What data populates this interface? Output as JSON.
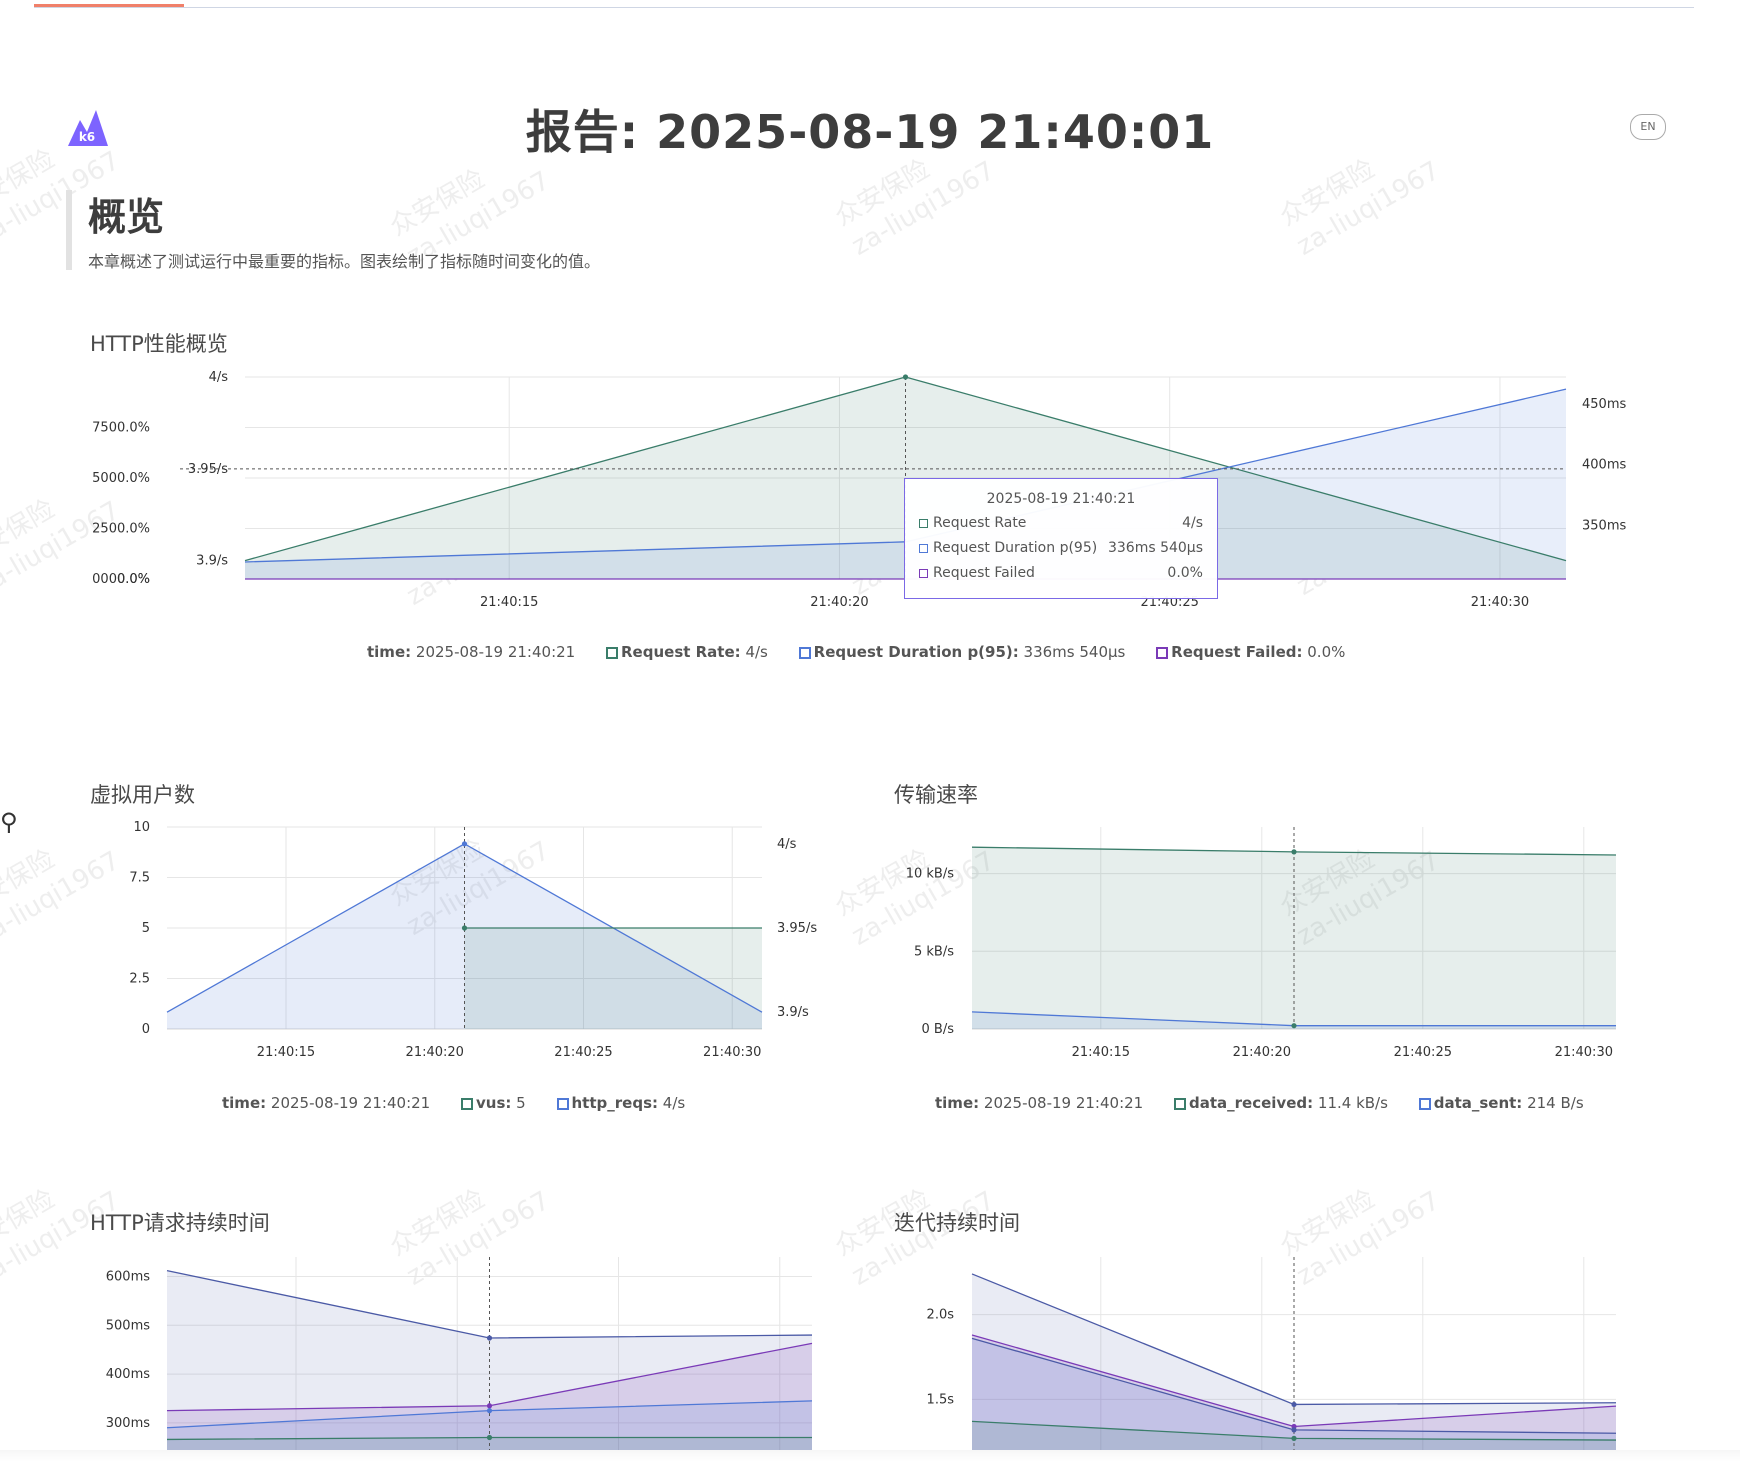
{
  "page": {
    "logo_text": "k6",
    "title": "报告: 2025-08-19 21:40:01",
    "lang_button": "EN",
    "section_title": "概览",
    "section_desc": "本章概述了测试运行中最重要的指标。图表绘制了指标随时间变化的值。"
  },
  "watermark": {
    "line1": "众安保险",
    "line2": "za-liuqi1967"
  },
  "colors": {
    "green": "#3a7d6a",
    "blue": "#4f78d6",
    "purple": "#7a3ab7",
    "navy": "#4b5aa6",
    "title": "#3d3d3d"
  },
  "http_overview": {
    "title": "HTTP性能概览",
    "tooltip": {
      "time": "2025-08-19 21:40:21",
      "rows": [
        {
          "name": "Request Rate",
          "value": "4/s"
        },
        {
          "name": "Request Duration p(95)",
          "value": "336ms 540µs"
        },
        {
          "name": "Request Failed",
          "value": "0.0%"
        }
      ]
    },
    "legend": {
      "time_label": "time:",
      "time_value": "2025-08-19 21:40:21",
      "items": [
        {
          "label": "Request Rate:",
          "value": "4/s"
        },
        {
          "label": "Request Duration p(95):",
          "value": "336ms 540µs"
        },
        {
          "label": "Request Failed:",
          "value": "0.0%"
        }
      ]
    }
  },
  "vus_chart": {
    "title": "虚拟用户数",
    "legend": {
      "time_label": "time:",
      "time_value": "2025-08-19 21:40:21",
      "items": [
        {
          "label": "vus:",
          "value": "5"
        },
        {
          "label": "http_reqs:",
          "value": "4/s"
        }
      ]
    }
  },
  "transfer_chart": {
    "title": "传输速率",
    "legend": {
      "time_label": "time:",
      "time_value": "2025-08-19 21:40:21",
      "items": [
        {
          "label": "data_received:",
          "value": "11.4 kB/s"
        },
        {
          "label": "data_sent:",
          "value": "214 B/s"
        }
      ]
    }
  },
  "http_duration_chart": {
    "title": "HTTP请求持续时间"
  },
  "iteration_chart": {
    "title": "迭代持续时间"
  },
  "chart_data": [
    {
      "type": "area",
      "title": "HTTP性能概览",
      "x": [
        "21:40:11",
        "21:40:21",
        "21:40:31"
      ],
      "x_ticks": [
        "21:40:15",
        "21:40:20",
        "21:40:25",
        "21:40:30"
      ],
      "xlim": [
        "21:40:11",
        "21:40:31"
      ],
      "y_left_pct": {
        "ticks": [
          "0.0%",
          "2500.0%",
          "5000.0%",
          "7500.0%",
          "0000.0%"
        ],
        "ylim": [
          0,
          10000
        ]
      },
      "y_left_rate": {
        "ticks": [
          "3.9/s",
          "3.95/s",
          "4/s"
        ],
        "ylim": [
          3.89,
          4.0
        ]
      },
      "y_right": {
        "ticks": [
          "350ms",
          "400ms",
          "450ms"
        ],
        "ylim": [
          306,
          472
        ]
      },
      "series": [
        {
          "name": "Request Rate",
          "axis": "rate",
          "values": [
            3.9,
            4.0,
            3.9
          ]
        },
        {
          "name": "Request Duration p(95)",
          "axis": "ms",
          "values": [
            320,
            336.54,
            462
          ]
        },
        {
          "name": "Request Failed",
          "axis": "pct",
          "values": [
            0,
            0,
            0
          ]
        }
      ],
      "grid": true
    },
    {
      "type": "area",
      "title": "虚拟用户数",
      "x": [
        "21:40:11",
        "21:40:21",
        "21:40:31"
      ],
      "x_ticks": [
        "21:40:15",
        "21:40:20",
        "21:40:25",
        "21:40:30"
      ],
      "xlim": [
        "21:40:11",
        "21:40:31"
      ],
      "y_left": {
        "ticks": [
          "0",
          "2.5",
          "5",
          "7.5",
          "10"
        ],
        "ylim": [
          0,
          10
        ]
      },
      "y_right": {
        "ticks": [
          "3.9/s",
          "3.95/s",
          "4/s"
        ],
        "ylim": [
          3.89,
          4.01
        ]
      },
      "series": [
        {
          "name": "vus",
          "axis": "left",
          "values": [
            null,
            5,
            5
          ]
        },
        {
          "name": "http_reqs",
          "axis": "right",
          "values": [
            3.9,
            4.0,
            3.9
          ]
        }
      ],
      "grid": true
    },
    {
      "type": "area",
      "title": "传输速率",
      "x": [
        "21:40:11",
        "21:40:21",
        "21:40:31"
      ],
      "x_ticks": [
        "21:40:15",
        "21:40:20",
        "21:40:25",
        "21:40:30"
      ],
      "xlim": [
        "21:40:11",
        "21:40:31"
      ],
      "y": {
        "ticks": [
          "0 B/s",
          "5 kB/s",
          "10 kB/s"
        ],
        "ylim": [
          0,
          13000
        ]
      },
      "series": [
        {
          "name": "data_received",
          "values": [
            11700,
            11400,
            11200
          ]
        },
        {
          "name": "data_sent",
          "values": [
            1100,
            214,
            214
          ]
        }
      ],
      "grid": true
    },
    {
      "type": "area",
      "title": "HTTP请求持续时间",
      "x": [
        "21:40:11",
        "21:40:21",
        "21:40:31"
      ],
      "xlim": [
        "21:40:11",
        "21:40:31"
      ],
      "y": {
        "ticks": [
          "300ms",
          "400ms",
          "500ms",
          "600ms"
        ],
        "ylim": [
          230,
          640
        ]
      },
      "series": [
        {
          "values": [
            612,
            474,
            480
          ]
        },
        {
          "values": [
            325,
            335,
            463
          ]
        },
        {
          "values": [
            290,
            325,
            345
          ]
        },
        {
          "values": [
            266,
            270,
            270
          ]
        }
      ],
      "grid": true
    },
    {
      "type": "area",
      "title": "迭代持续时间",
      "x": [
        "21:40:11",
        "21:40:21",
        "21:40:31"
      ],
      "xlim": [
        "21:40:11",
        "21:40:31"
      ],
      "y": {
        "ticks": [
          "1.5s",
          "2.0s"
        ],
        "ylim": [
          1.16,
          2.34
        ]
      },
      "series": [
        {
          "values": [
            2.24,
            1.47,
            1.48
          ]
        },
        {
          "values": [
            1.88,
            1.34,
            1.46
          ]
        },
        {
          "values": [
            1.86,
            1.32,
            1.3
          ]
        },
        {
          "values": [
            1.37,
            1.27,
            1.26
          ]
        }
      ],
      "grid": true
    }
  ]
}
